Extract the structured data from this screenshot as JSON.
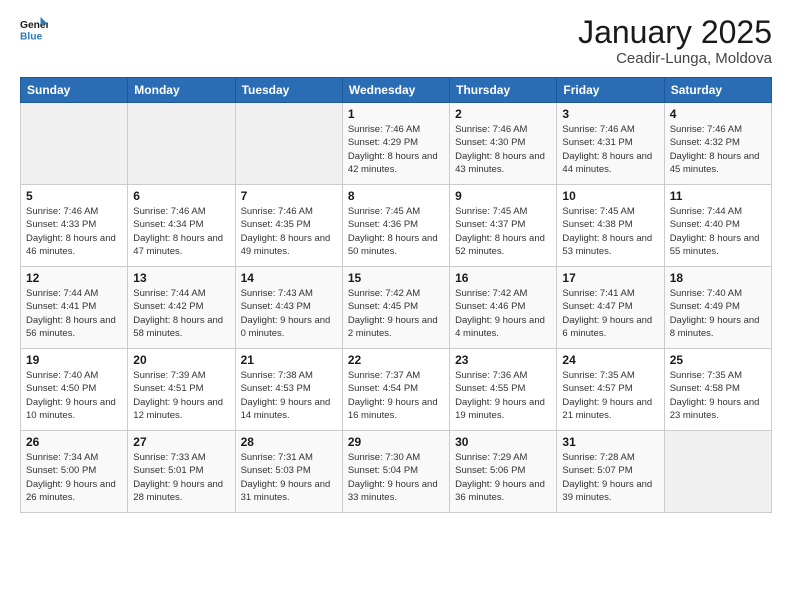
{
  "logo": {
    "text_general": "General",
    "text_blue": "Blue"
  },
  "header": {
    "title": "January 2025",
    "subtitle": "Ceadir-Lunga, Moldova"
  },
  "weekdays": [
    "Sunday",
    "Monday",
    "Tuesday",
    "Wednesday",
    "Thursday",
    "Friday",
    "Saturday"
  ],
  "weeks": [
    [
      {
        "day": "",
        "info": ""
      },
      {
        "day": "",
        "info": ""
      },
      {
        "day": "",
        "info": ""
      },
      {
        "day": "1",
        "info": "Sunrise: 7:46 AM\nSunset: 4:29 PM\nDaylight: 8 hours and 42 minutes."
      },
      {
        "day": "2",
        "info": "Sunrise: 7:46 AM\nSunset: 4:30 PM\nDaylight: 8 hours and 43 minutes."
      },
      {
        "day": "3",
        "info": "Sunrise: 7:46 AM\nSunset: 4:31 PM\nDaylight: 8 hours and 44 minutes."
      },
      {
        "day": "4",
        "info": "Sunrise: 7:46 AM\nSunset: 4:32 PM\nDaylight: 8 hours and 45 minutes."
      }
    ],
    [
      {
        "day": "5",
        "info": "Sunrise: 7:46 AM\nSunset: 4:33 PM\nDaylight: 8 hours and 46 minutes."
      },
      {
        "day": "6",
        "info": "Sunrise: 7:46 AM\nSunset: 4:34 PM\nDaylight: 8 hours and 47 minutes."
      },
      {
        "day": "7",
        "info": "Sunrise: 7:46 AM\nSunset: 4:35 PM\nDaylight: 8 hours and 49 minutes."
      },
      {
        "day": "8",
        "info": "Sunrise: 7:45 AM\nSunset: 4:36 PM\nDaylight: 8 hours and 50 minutes."
      },
      {
        "day": "9",
        "info": "Sunrise: 7:45 AM\nSunset: 4:37 PM\nDaylight: 8 hours and 52 minutes."
      },
      {
        "day": "10",
        "info": "Sunrise: 7:45 AM\nSunset: 4:38 PM\nDaylight: 8 hours and 53 minutes."
      },
      {
        "day": "11",
        "info": "Sunrise: 7:44 AM\nSunset: 4:40 PM\nDaylight: 8 hours and 55 minutes."
      }
    ],
    [
      {
        "day": "12",
        "info": "Sunrise: 7:44 AM\nSunset: 4:41 PM\nDaylight: 8 hours and 56 minutes."
      },
      {
        "day": "13",
        "info": "Sunrise: 7:44 AM\nSunset: 4:42 PM\nDaylight: 8 hours and 58 minutes."
      },
      {
        "day": "14",
        "info": "Sunrise: 7:43 AM\nSunset: 4:43 PM\nDaylight: 9 hours and 0 minutes."
      },
      {
        "day": "15",
        "info": "Sunrise: 7:42 AM\nSunset: 4:45 PM\nDaylight: 9 hours and 2 minutes."
      },
      {
        "day": "16",
        "info": "Sunrise: 7:42 AM\nSunset: 4:46 PM\nDaylight: 9 hours and 4 minutes."
      },
      {
        "day": "17",
        "info": "Sunrise: 7:41 AM\nSunset: 4:47 PM\nDaylight: 9 hours and 6 minutes."
      },
      {
        "day": "18",
        "info": "Sunrise: 7:40 AM\nSunset: 4:49 PM\nDaylight: 9 hours and 8 minutes."
      }
    ],
    [
      {
        "day": "19",
        "info": "Sunrise: 7:40 AM\nSunset: 4:50 PM\nDaylight: 9 hours and 10 minutes."
      },
      {
        "day": "20",
        "info": "Sunrise: 7:39 AM\nSunset: 4:51 PM\nDaylight: 9 hours and 12 minutes."
      },
      {
        "day": "21",
        "info": "Sunrise: 7:38 AM\nSunset: 4:53 PM\nDaylight: 9 hours and 14 minutes."
      },
      {
        "day": "22",
        "info": "Sunrise: 7:37 AM\nSunset: 4:54 PM\nDaylight: 9 hours and 16 minutes."
      },
      {
        "day": "23",
        "info": "Sunrise: 7:36 AM\nSunset: 4:55 PM\nDaylight: 9 hours and 19 minutes."
      },
      {
        "day": "24",
        "info": "Sunrise: 7:35 AM\nSunset: 4:57 PM\nDaylight: 9 hours and 21 minutes."
      },
      {
        "day": "25",
        "info": "Sunrise: 7:35 AM\nSunset: 4:58 PM\nDaylight: 9 hours and 23 minutes."
      }
    ],
    [
      {
        "day": "26",
        "info": "Sunrise: 7:34 AM\nSunset: 5:00 PM\nDaylight: 9 hours and 26 minutes."
      },
      {
        "day": "27",
        "info": "Sunrise: 7:33 AM\nSunset: 5:01 PM\nDaylight: 9 hours and 28 minutes."
      },
      {
        "day": "28",
        "info": "Sunrise: 7:31 AM\nSunset: 5:03 PM\nDaylight: 9 hours and 31 minutes."
      },
      {
        "day": "29",
        "info": "Sunrise: 7:30 AM\nSunset: 5:04 PM\nDaylight: 9 hours and 33 minutes."
      },
      {
        "day": "30",
        "info": "Sunrise: 7:29 AM\nSunset: 5:06 PM\nDaylight: 9 hours and 36 minutes."
      },
      {
        "day": "31",
        "info": "Sunrise: 7:28 AM\nSunset: 5:07 PM\nDaylight: 9 hours and 39 minutes."
      },
      {
        "day": "",
        "info": ""
      }
    ]
  ]
}
